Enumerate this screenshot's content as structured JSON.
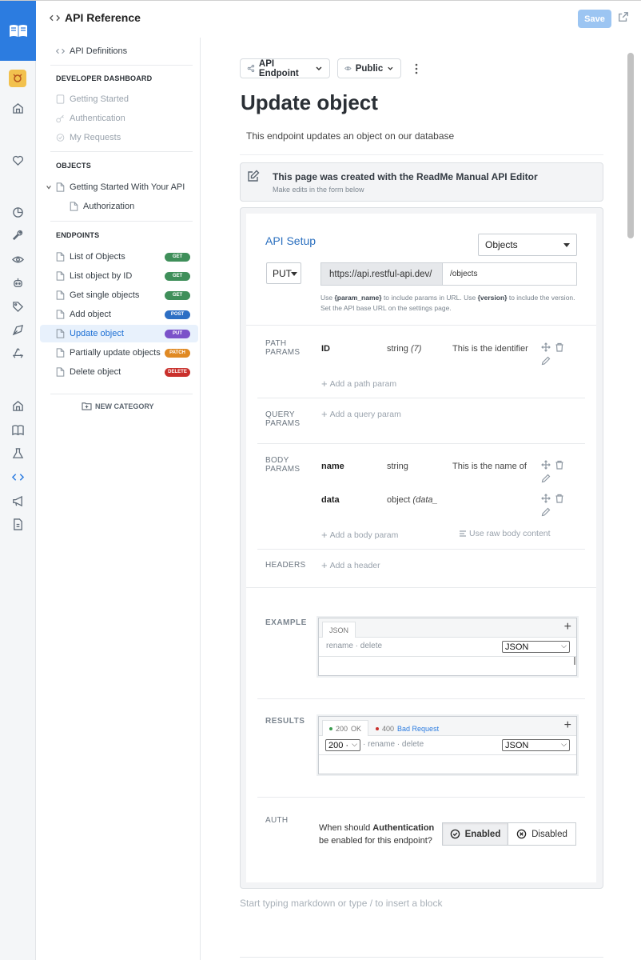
{
  "header": {
    "title": "API Reference",
    "save_label": "Save"
  },
  "sidebar": {
    "api_definitions": "API Definitions",
    "developer_dashboard": {
      "heading": "DEVELOPER DASHBOARD",
      "items": [
        "Getting Started",
        "Authentication",
        "My Requests"
      ]
    },
    "objects": {
      "heading": "OBJECTS",
      "parent": "Getting Started With Your API",
      "child": "Authorization"
    },
    "endpoints": {
      "heading": "ENDPOINTS",
      "items": [
        {
          "label": "List of Objects",
          "method": "GET",
          "color": "#3f8f5a"
        },
        {
          "label": "List object by ID",
          "method": "GET",
          "color": "#3f8f5a"
        },
        {
          "label": "Get single objects",
          "method": "GET",
          "color": "#3f8f5a"
        },
        {
          "label": "Add object",
          "method": "POST",
          "color": "#2d6fc4"
        },
        {
          "label": "Update object",
          "method": "PUT",
          "color": "#7b52c9"
        },
        {
          "label": "Partially update objects",
          "method": "PATCH",
          "color": "#e08a24"
        },
        {
          "label": "Delete object",
          "method": "DELETE",
          "color": "#c9302c"
        }
      ],
      "active_index": 4
    },
    "new_category": "NEW CATEGORY"
  },
  "toolbar": {
    "type_label": "API Endpoint",
    "visibility_label": "Public"
  },
  "page": {
    "title": "Update object",
    "description": "This endpoint updates an object on our database"
  },
  "callout": {
    "title": "This page was created with the ReadMe Manual API Editor",
    "subtitle": "Make edits in the form below"
  },
  "api_setup": {
    "heading": "API Setup",
    "category_select": "Objects",
    "method": "PUT",
    "base_url": "https://api.restful-api.dev/",
    "path": "/objects",
    "help_1": "Use",
    "help_param": "{param_name}",
    "help_2": "to include params in URL. Use",
    "help_version": "{version}",
    "help_3": "to include the version. Set the API base URL on the settings page."
  },
  "path_params": {
    "label_1": "PATH",
    "label_2": "PARAMS",
    "items": [
      {
        "name": "ID",
        "type": "string",
        "type_extra": "(7)",
        "desc": "This is the identifier"
      }
    ],
    "add_label": "Add a path param"
  },
  "query_params": {
    "label_1": "QUERY",
    "label_2": "PARAMS",
    "add_label": "Add a query param"
  },
  "body_params": {
    "label_1": "BODY",
    "label_2": "PARAMS",
    "items": [
      {
        "name": "name",
        "type": "string",
        "type_extra": "",
        "desc": "This is the name of"
      },
      {
        "name": "data",
        "type": "object",
        "type_extra": "(data_",
        "desc": ""
      }
    ],
    "add_label": "Add a body param",
    "raw_label": "Use raw body content"
  },
  "headers": {
    "label": "HEADERS",
    "add_label": "Add a header"
  },
  "example": {
    "label": "EXAMPLE",
    "tab": "JSON",
    "meta": "rename · delete",
    "format": "JSON"
  },
  "results": {
    "label": "RESULTS",
    "tab_ok_code": "200",
    "tab_ok_text": "OK",
    "tab_err_code": "400",
    "tab_err_text": "Bad Request",
    "status_select": "200 ·",
    "meta": "· rename · delete",
    "format": "JSON",
    "colors": {
      "ok": "#3a9c4f",
      "err": "#c9302c"
    }
  },
  "auth": {
    "label": "AUTH",
    "question_1": "When should",
    "question_bold": "Authentication",
    "question_2": "be enabled for this endpoint?",
    "enabled": "Enabled",
    "disabled": "Disabled"
  },
  "editor_hint": "Start typing markdown or type / to insert a block"
}
